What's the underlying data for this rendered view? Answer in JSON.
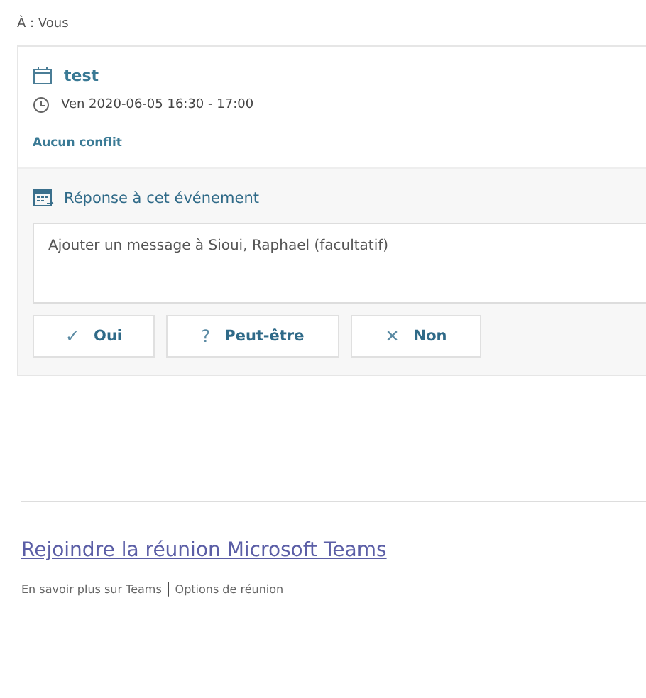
{
  "recipient": {
    "label": "À :",
    "value": "Vous"
  },
  "event": {
    "title": "test",
    "time": "Ven 2020-06-05 16:30 - 17:00",
    "conflict": "Aucun conflit"
  },
  "response": {
    "heading": "Réponse à cet événement",
    "placeholder": "Ajouter un message à Sioui, Raphael (facultatif)",
    "buttons": [
      {
        "icon": "✓",
        "label": "Oui"
      },
      {
        "icon": "?",
        "label": "Peut-être"
      },
      {
        "icon": "✕",
        "label": "Non"
      }
    ]
  },
  "teams": {
    "join_link": "Rejoindre la réunion Microsoft Teams",
    "links": [
      "En savoir plus sur Teams",
      "Options de réunion"
    ],
    "separator": "|"
  }
}
